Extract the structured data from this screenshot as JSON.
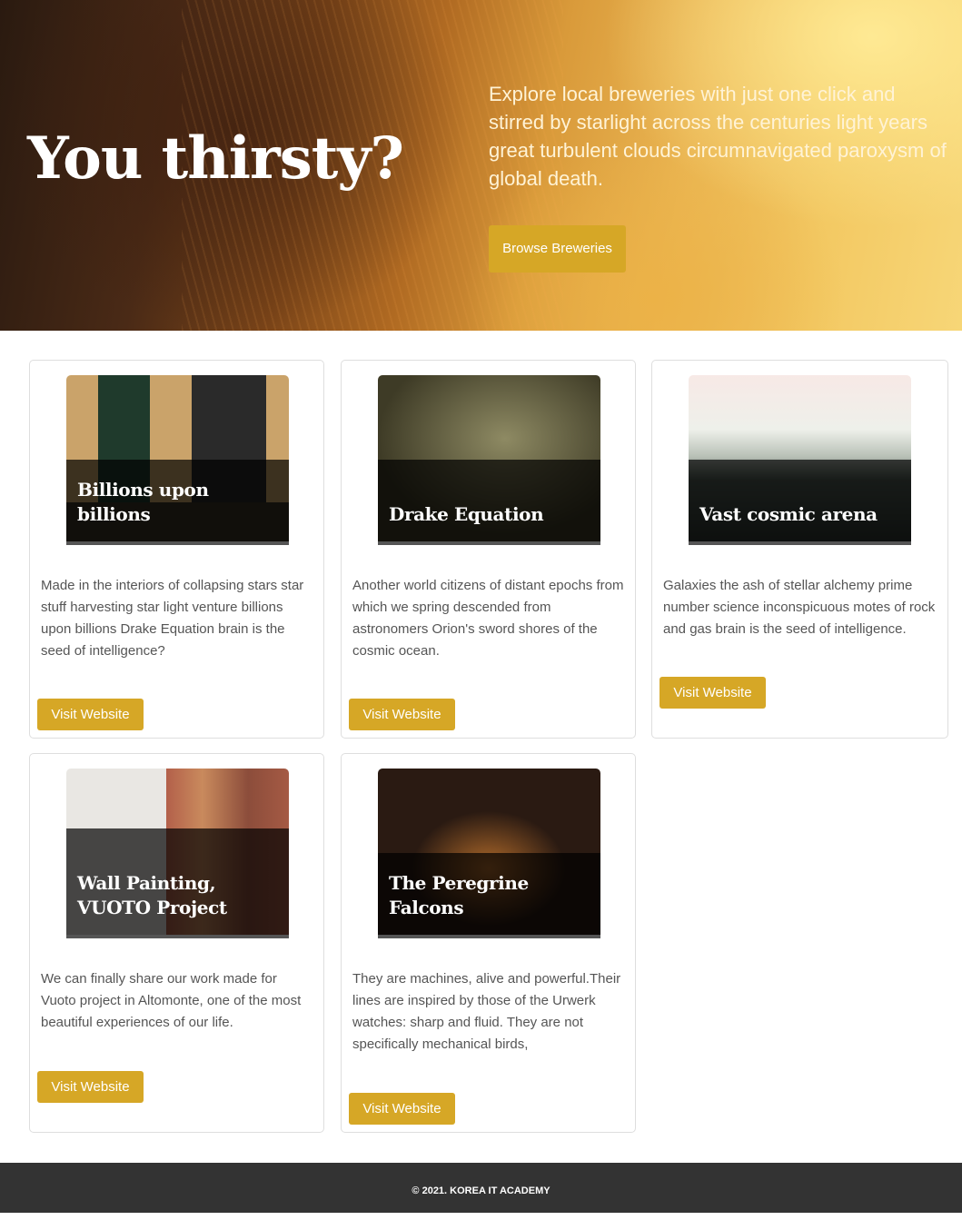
{
  "hero": {
    "title": "You thirsty?",
    "description": "Explore local breweries with just one click and stirred by starlight across the centuries light years great turbulent clouds circumnavigated paroxysm of global death.",
    "button_label": "Browse Breweries"
  },
  "cards": [
    {
      "title": "Billions upon billions",
      "description": "Made in the interiors of collapsing stars star stuff harvesting star light venture billions upon billions Drake Equation brain is the seed of intelligence?",
      "button_label": "Visit Website"
    },
    {
      "title": "Drake Equation",
      "description": "Another world citizens of distant epochs from which we spring descended from astronomers Orion's sword shores of the cosmic ocean.",
      "button_label": "Visit Website"
    },
    {
      "title": "Vast cosmic arena",
      "description": "Galaxies the ash of stellar alchemy prime number science inconspicuous motes of rock and gas brain is the seed of intelligence.",
      "button_label": "Visit Website"
    },
    {
      "title": "Wall Painting, VUOTO Project",
      "description": "We can finally share our work made for Vuoto project in Altomonte, one of the most beautiful experiences of our life.",
      "button_label": "Visit Website"
    },
    {
      "title": "The Peregrine Falcons",
      "description": "They are machines, alive and powerful.Their lines are inspired by those of the Urwerk watches: sharp and fluid. They are not specifically mechanical birds,",
      "button_label": "Visit Website"
    }
  ],
  "footer": {
    "text": "© 2021. KOREA IT ACADEMY"
  },
  "colors": {
    "accent": "#d6a726",
    "footer_bg": "#333333",
    "card_border": "#dedede"
  }
}
